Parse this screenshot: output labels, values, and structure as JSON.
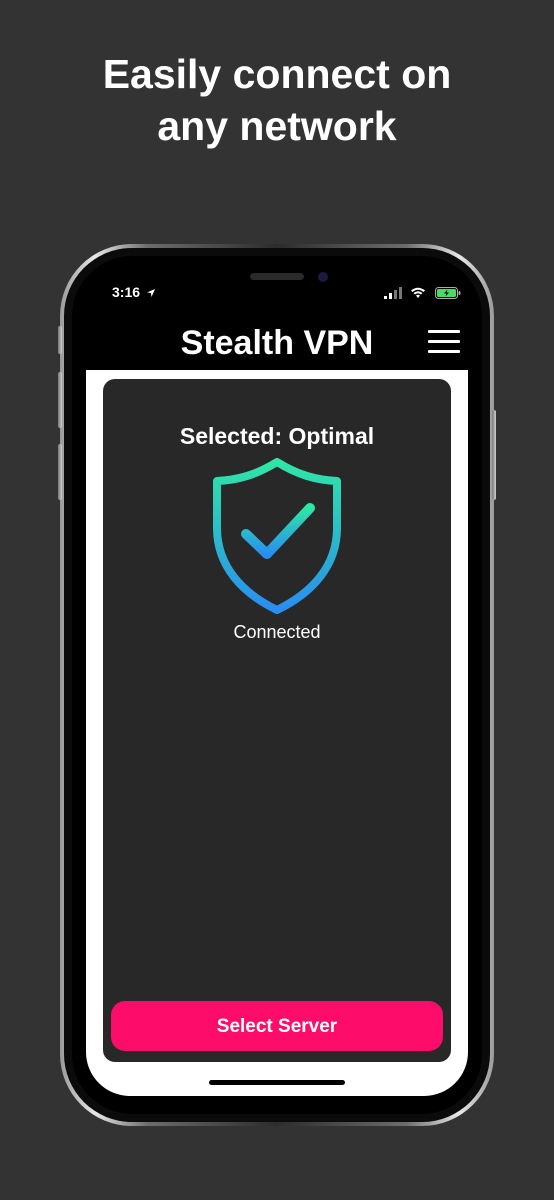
{
  "promo": {
    "headline_line1": "Easily connect on",
    "headline_line2": "any network"
  },
  "status_bar": {
    "time": "3:16",
    "icons": [
      "location-arrow-icon",
      "signal-icon",
      "wifi-icon",
      "battery-charging-icon"
    ]
  },
  "app": {
    "title": "Stealth VPN",
    "menu_icon": "hamburger-menu-icon"
  },
  "connection": {
    "selected_label": "Selected: Optimal",
    "status_icon": "shield-check-icon",
    "status_text": "Connected"
  },
  "actions": {
    "select_server_label": "Select Server"
  },
  "colors": {
    "background": "#333333",
    "card": "#282828",
    "accent_button": "#fe0c6a",
    "shield_gradient_top": "#2ee6a6",
    "shield_gradient_bottom": "#2a8df0"
  }
}
